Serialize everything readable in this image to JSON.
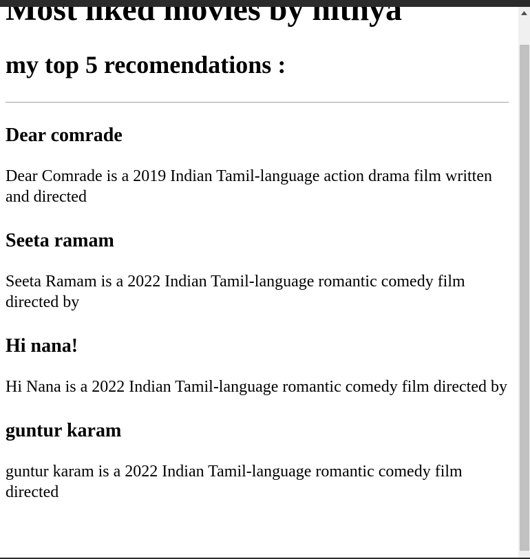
{
  "page": {
    "title": "Most liked movies by nithya",
    "subtitle": "my top 5 recomendations :"
  },
  "movies": [
    {
      "title": "Dear comrade",
      "description": "Dear Comrade is a 2019 Indian Tamil-language action drama film written and directed"
    },
    {
      "title": "Seeta ramam",
      "description": "Seeta Ramam is a 2022 Indian Tamil-language romantic comedy film directed by"
    },
    {
      "title": "Hi nana!",
      "description": "Hi Nana is a 2022 Indian Tamil-language romantic comedy film directed by"
    },
    {
      "title": "guntur karam",
      "description": "guntur karam is a 2022 Indian Tamil-language romantic comedy film directed"
    }
  ],
  "scrollbar": {
    "up_icon": "chevron-up-icon"
  }
}
